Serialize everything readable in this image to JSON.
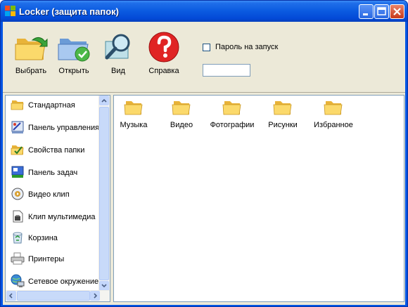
{
  "window": {
    "title": "Locker (защита папок)"
  },
  "toolbar": {
    "buttons": [
      {
        "label": "Выбрать",
        "icon": "folder-arrow-icon"
      },
      {
        "label": "Открыть",
        "icon": "folder-check-icon"
      },
      {
        "label": "Вид",
        "icon": "magnifier-icon"
      },
      {
        "label": "Справка",
        "icon": "help-icon"
      }
    ],
    "password_checkbox": {
      "label": "Пароль на запуск",
      "checked": false
    },
    "password_input": {
      "value": ""
    }
  },
  "sidebar": {
    "items": [
      {
        "label": "Стандартная",
        "icon": "folder-icon"
      },
      {
        "label": "Панель управления",
        "icon": "control-panel-icon"
      },
      {
        "label": "Свойства папки",
        "icon": "folder-options-icon"
      },
      {
        "label": "Панель задач",
        "icon": "taskbar-icon"
      },
      {
        "label": "Видео клип",
        "icon": "video-clip-icon"
      },
      {
        "label": "Клип мультимедиа",
        "icon": "multimedia-icon"
      },
      {
        "label": "Корзина",
        "icon": "recycle-bin-icon"
      },
      {
        "label": "Принтеры",
        "icon": "printer-icon"
      },
      {
        "label": "Сетевое окружение",
        "icon": "network-icon"
      }
    ]
  },
  "folders": [
    {
      "label": "Музыка"
    },
    {
      "label": "Видео"
    },
    {
      "label": "Фотографии"
    },
    {
      "label": "Рисунки"
    },
    {
      "label": "Избранное"
    }
  ],
  "colors": {
    "title_bar": "#0a5ae0",
    "dialog_bg": "#ece9d8",
    "folder_yellow": "#f8d775"
  }
}
